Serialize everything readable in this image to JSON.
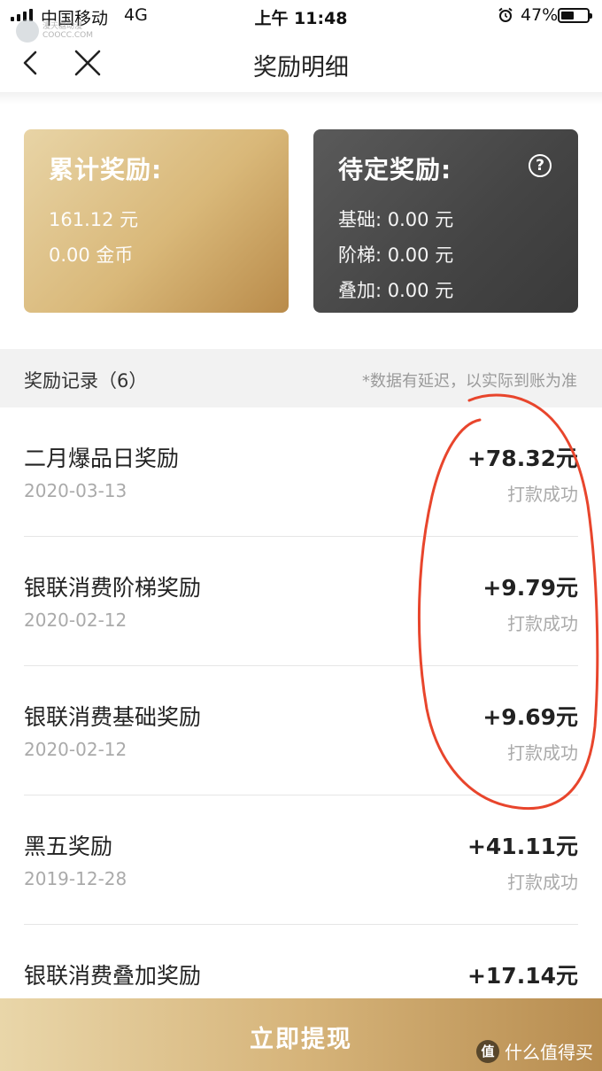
{
  "status_bar": {
    "carrier": "中国移动",
    "network": "4G",
    "time": "上午 11:48",
    "battery_percent": "47%"
  },
  "watermark": {
    "line1": "漫天糖动漫",
    "line2": "COOCC.COM"
  },
  "nav": {
    "title": "奖励明细"
  },
  "cumulative_card": {
    "title": "累计奖励:",
    "cash": "161.12 元",
    "coins": "0.00 金币"
  },
  "pending_card": {
    "title": "待定奖励:",
    "help_icon": "?",
    "lines": [
      {
        "label": "基础:",
        "value": "0.00 元"
      },
      {
        "label": "阶梯:",
        "value": "0.00 元"
      },
      {
        "label": "叠加:",
        "value": "0.00 元"
      }
    ]
  },
  "records": {
    "title": "奖励记录（6）",
    "note": "*数据有延迟，以实际到账为准",
    "items": [
      {
        "name": "二月爆品日奖励",
        "date": "2020-03-13",
        "amount": "+78.32元",
        "status": "打款成功"
      },
      {
        "name": "银联消费阶梯奖励",
        "date": "2020-02-12",
        "amount": "+9.79元",
        "status": "打款成功"
      },
      {
        "name": "银联消费基础奖励",
        "date": "2020-02-12",
        "amount": "+9.69元",
        "status": "打款成功"
      },
      {
        "name": "黑五奖励",
        "date": "2019-12-28",
        "amount": "+41.11元",
        "status": "打款成功"
      },
      {
        "name": "银联消费叠加奖励",
        "date": "",
        "amount": "+17.14元",
        "status": ""
      }
    ]
  },
  "withdraw_button": {
    "label": "立即提现"
  },
  "corner_logo": {
    "badge": "值",
    "text": "什么值得买"
  },
  "colors": {
    "gold_start": "#e8d4a6",
    "gold_end": "#b98b4a",
    "dark_card": "#444444",
    "annotation": "#e8452c"
  }
}
